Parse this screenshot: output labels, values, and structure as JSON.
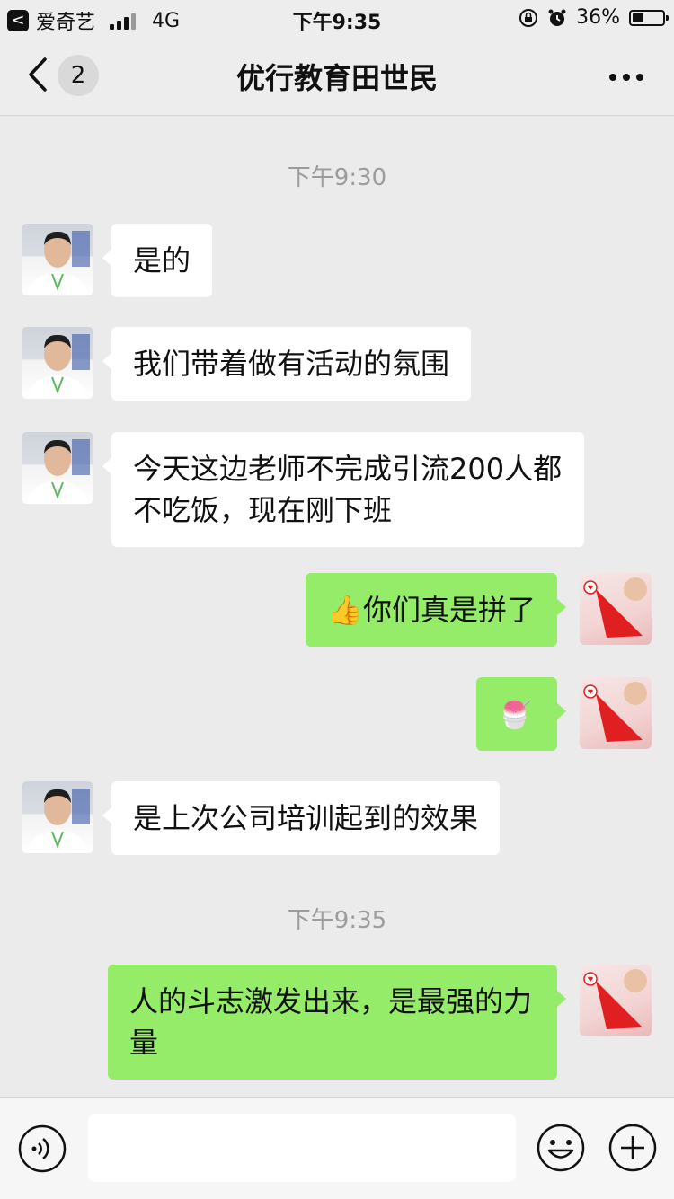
{
  "status_bar": {
    "back_app": "爱奇艺",
    "back_glyph": "<",
    "network": "4G",
    "time": "下午9:35",
    "battery_percent": "36%",
    "battery_level": 0.36
  },
  "nav": {
    "unread_count": "2",
    "title": "优行教育田世民"
  },
  "messages": [
    {
      "kind": "time",
      "text": "下午9:30"
    },
    {
      "kind": "msg",
      "side": "left",
      "text": "是的"
    },
    {
      "kind": "msg",
      "side": "left",
      "text": "我们带着做有活动的氛围"
    },
    {
      "kind": "msg",
      "side": "left",
      "text": "今天这边老师不完成引流200人都不吃饭，现在刚下班"
    },
    {
      "kind": "msg",
      "side": "right",
      "emoji": "👍",
      "text": "你们真是拼了"
    },
    {
      "kind": "msg",
      "side": "right",
      "emoji": "🍧",
      "text": ""
    },
    {
      "kind": "msg",
      "side": "left",
      "text": "是上次公司培训起到的效果"
    },
    {
      "kind": "time",
      "text": "下午9:35"
    },
    {
      "kind": "msg",
      "side": "right",
      "text": "人的斗志激发出来，是最强的力量"
    }
  ],
  "input": {
    "placeholder": ""
  },
  "icons": {
    "voice": "voice-icon",
    "emoji": "emoji-icon",
    "plus": "plus-icon",
    "back": "chevron-left-icon",
    "more": "more-icon"
  },
  "colors": {
    "bubble_self": "#95ec69",
    "bubble_other": "#ffffff",
    "background": "#ebebeb"
  }
}
